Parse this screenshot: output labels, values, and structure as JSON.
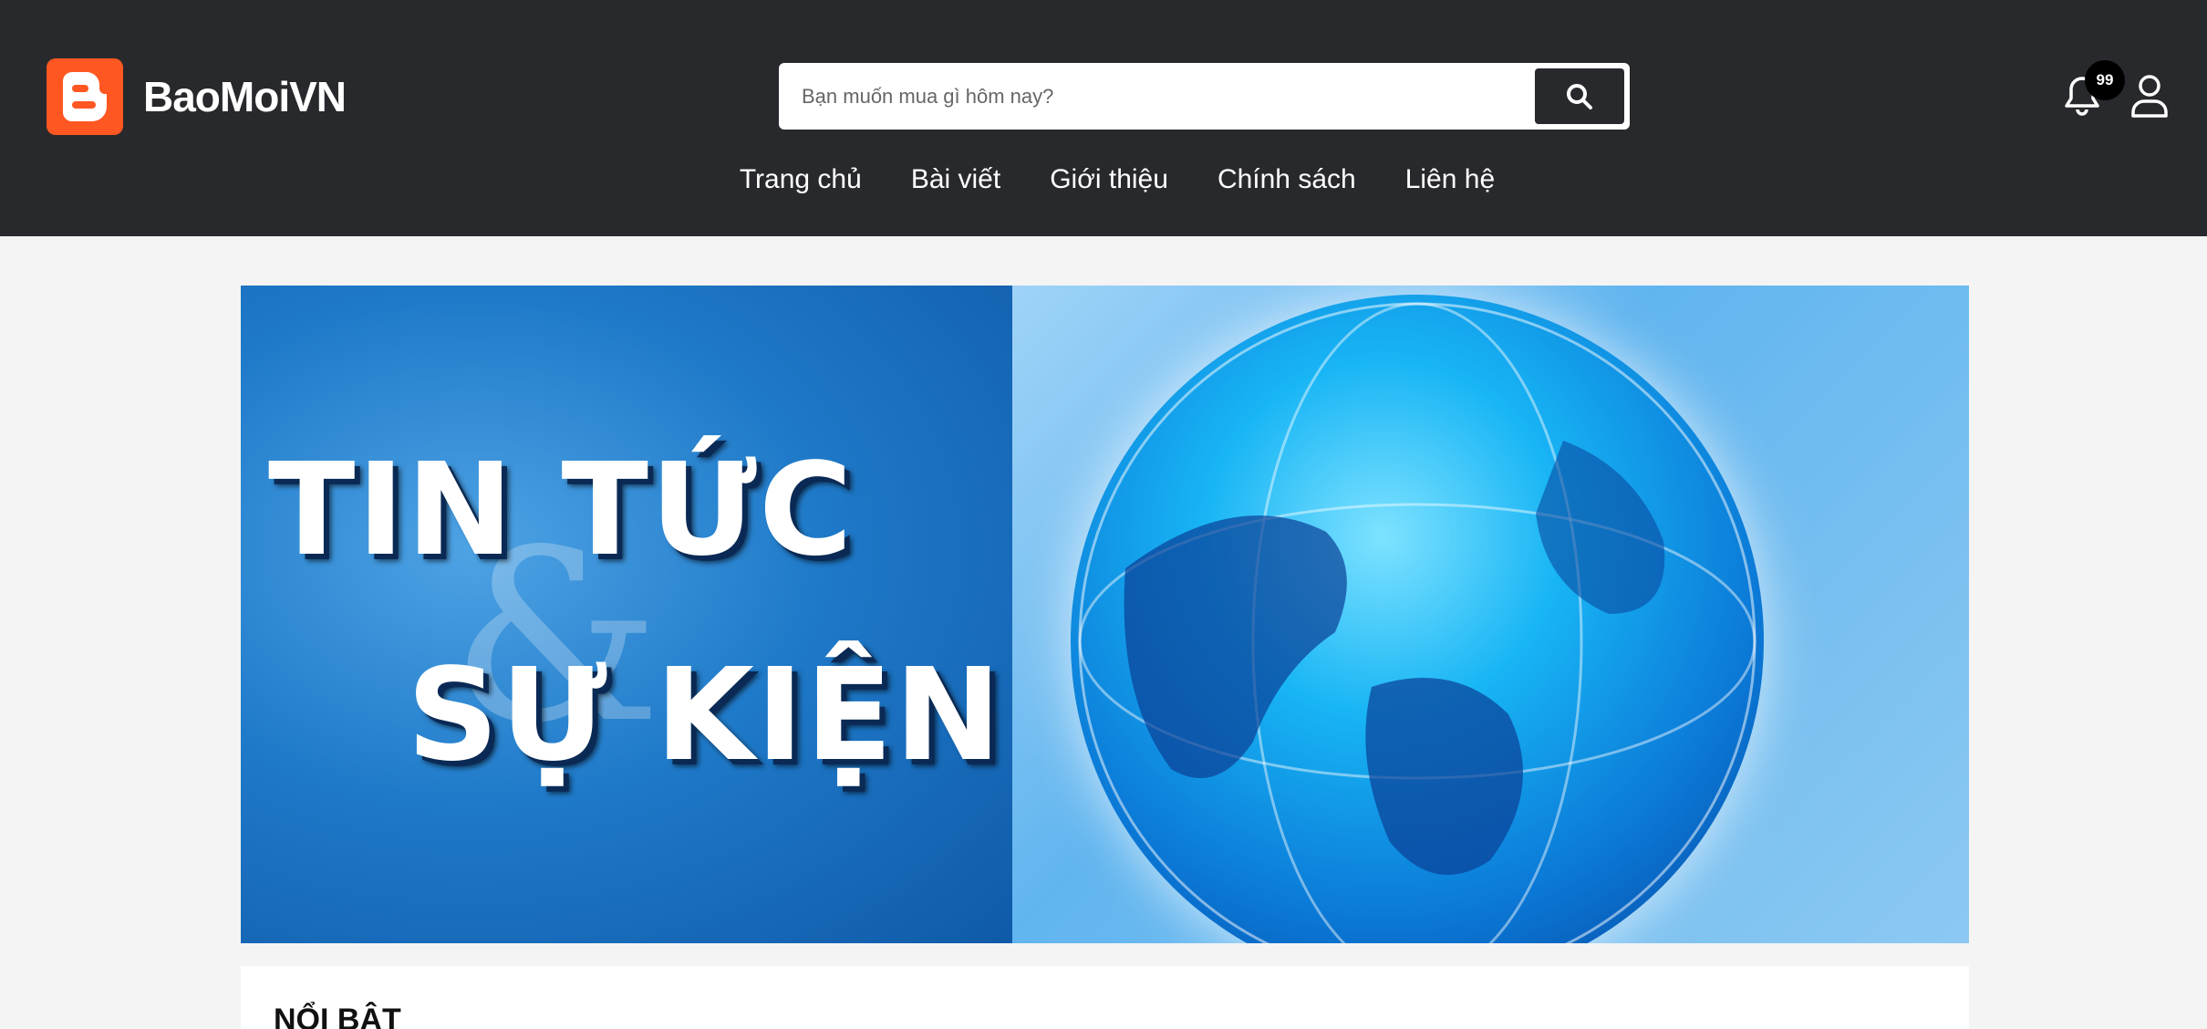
{
  "brand": {
    "name": "BaoMoiVN",
    "logo_color": "#ff5722"
  },
  "search": {
    "placeholder": "Bạn muốn mua gì hôm nay?",
    "button_icon": "search-icon"
  },
  "notifications": {
    "count": "99",
    "icon": "bell-icon"
  },
  "account": {
    "icon": "user-icon"
  },
  "nav": {
    "items": [
      {
        "label": "Trang chủ"
      },
      {
        "label": "Bài viết"
      },
      {
        "label": "Giới thiệu"
      },
      {
        "label": "Chính sách"
      },
      {
        "label": "Liên hệ"
      }
    ]
  },
  "banner": {
    "line1": "TIN TỨC",
    "amp": "&",
    "line2": "SỰ KIỆN"
  },
  "section": {
    "title": "NỔI BẬT"
  },
  "colors": {
    "header_bg": "#28292c",
    "page_bg": "#f4f4f4"
  }
}
